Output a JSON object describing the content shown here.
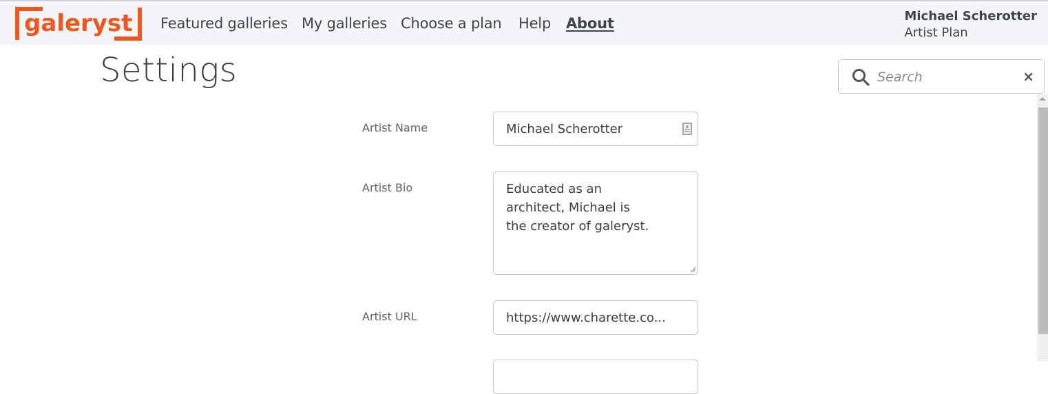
{
  "navbar": {
    "logo_text": "galeryst",
    "brand_color": "#f0561d",
    "links": [
      {
        "label": "Featured galleries",
        "active": false
      },
      {
        "label": "My galleries",
        "active": false
      },
      {
        "label": "Choose a plan",
        "active": false
      },
      {
        "label": "Help",
        "active": false
      },
      {
        "label": "About",
        "active": true
      }
    ],
    "user": {
      "name": "Michael Scherotter",
      "plan": "Artist Plan"
    }
  },
  "page": {
    "title": "Settings"
  },
  "search": {
    "placeholder": "Search",
    "value": "",
    "clear_label": "×"
  },
  "form": {
    "fields": [
      {
        "label": "Artist Name",
        "value": "Michael Scherotter",
        "type": "text",
        "icon": "contact-card-icon"
      },
      {
        "label": "Artist Bio",
        "value": "Educated as an architect, Michael is the creator of galeryst.",
        "type": "textarea"
      },
      {
        "label": "Artist URL",
        "value": "https://www.charette.co...",
        "type": "text"
      }
    ]
  }
}
